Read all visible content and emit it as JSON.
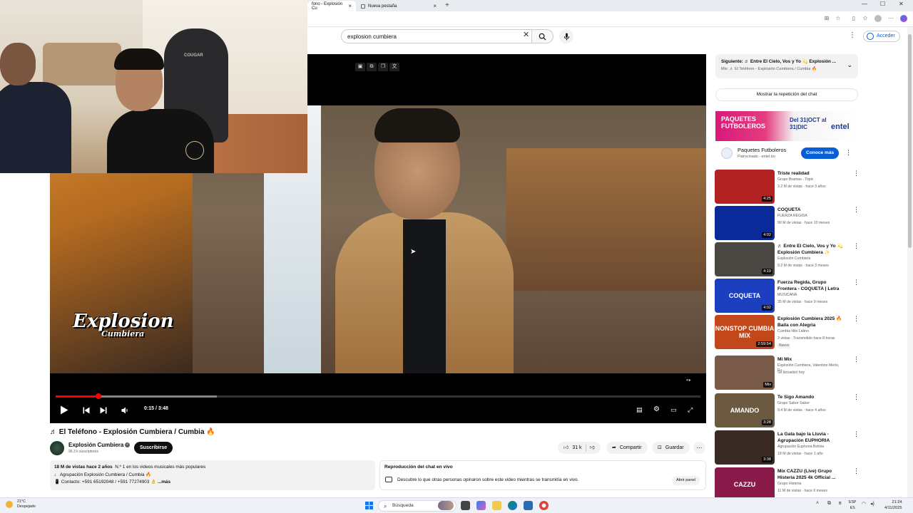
{
  "browser": {
    "tabs": [
      {
        "label": "fono - Explosión Cu",
        "active": true
      },
      {
        "label": "Nueva pestaña",
        "active": false
      }
    ]
  },
  "header": {
    "search_value": "explosion cumbiera",
    "signin_label": "Acceder"
  },
  "player": {
    "time_label": "0:15 / 3:48",
    "progress_fraction": 0.066,
    "buffer_fraction": 0.25,
    "overlay_logo_line1": "Explosion",
    "overlay_logo_line2": "Cumbiera",
    "accent_color": "#ff0000"
  },
  "webcam": {
    "chair_brand": "COUGAR"
  },
  "video": {
    "title": "♬ El Teléfono - Explosión Cumbiera / Cumbia 🔥",
    "channel": "Explosión Cumbiera",
    "subscribers": "96.3 k suscriptores",
    "subscribe_label": "Suscribirse",
    "likes": "31 k",
    "share_label": "Compartir",
    "save_label": "Guardar",
    "description": {
      "stats": "18 M de vistas  hace 2 años",
      "stats_rest": "N.º 1 en los videos musicales más populares",
      "line2": "♩ Agrupación Explosión Cumbiera / Cumbia 🔥",
      "line3": "📱 Contacto: +591 65192048 / +591 77274903 👌",
      "more": "...más"
    },
    "chat_replay": {
      "heading": "Reproducción del chat en vivo",
      "text": "Descubre lo que otras personas opinaron sobre este video mientras se transmitía en vivo.",
      "button": "Abrir panel"
    }
  },
  "sidebar": {
    "up_next_line1": "Siguiente: ♬ Entre El Cielo, Vos y Yo 💫 Explosión ...",
    "up_next_line2": "Mix: ♬ El Teléfono - Explosión Cumbiera / Cumbia 🔥",
    "show_chat": "Mostrar la repetición del chat",
    "ad": {
      "banner_left": "PAQUETES FUTBOLEROS",
      "banner_mid": "Del 31|OCT al 31|DIC",
      "banner_brand": "entel",
      "name": "Paquetes Futboleros",
      "sponsor": "Patrocinado · entel.bo",
      "cta": "Conoce más"
    },
    "items": [
      {
        "title": "Triste realidad",
        "channel": "Grupo Bramas - Topic",
        "meta": "3.2 M de vistas · hace 3 años",
        "duration": "4:25",
        "thumb_color": "#b22222",
        "thumb_text": ""
      },
      {
        "title": "COQUETA",
        "channel": "FUERZA REGIDA",
        "meta": "90 M de vistas · hace 10 meses",
        "duration": "4:02",
        "thumb_color": "#0b2a9a",
        "thumb_text": ""
      },
      {
        "title": "♬ Entre El Cielo, Vos y Yo 💫 Explosión Cumbiera ✨",
        "channel": "Explosión Cumbiera",
        "meta": "9.2 M de vistas · hace 3 meses",
        "duration": "4:19",
        "thumb_color": "#4a4642",
        "thumb_text": ""
      },
      {
        "title": "Fuerza Regida, Grupo Frontera - COQUETA | Letra",
        "channel": "MUSICANA",
        "meta": "35 M de vistas · hace 9 meses",
        "duration": "4:02",
        "thumb_color": "#1c3fbf",
        "thumb_text": "COQUETA"
      },
      {
        "title": "Explosión Cumbiera 2025 🔥 Baila con Alegria",
        "channel": "Cumbia Hits Latino",
        "meta": "3 vistas · Transmitido hace 8 horas",
        "badge": "Nuevo",
        "duration": "2:59:54",
        "thumb_color": "#c2471b",
        "thumb_text": "NONSTOP CUMBIA MIX"
      },
      {
        "title": "Mi Mix",
        "channel": "Explosión Cumbiera, Valentino Merlo, Fu...",
        "meta": "Se actualizó hoy",
        "duration": "Mix",
        "thumb_color": "#7a5a48",
        "thumb_text": ""
      },
      {
        "title": "Te Sigo Amando",
        "channel": "Grupo Sabor Sabor",
        "meta": "9.4 M de vistas · hace 4 años",
        "duration": "3:28",
        "thumb_color": "#6b5a40",
        "thumb_text": "AMANDO"
      },
      {
        "title": "La Gata bajo la Lluvia - Agrupación EUPHORIA",
        "channel": "Agrupación Euphoria Bolivia",
        "meta": "18 M de vistas · hace 1 año",
        "duration": "3:38",
        "thumb_color": "#3a2a24",
        "thumb_text": ""
      },
      {
        "title": "Mix CAZZU (Live) Grupo Histeria 2025 4k Official ...",
        "channel": "Grupo Histeria",
        "meta": "11 M de vistas · hace 6 meses",
        "duration": "",
        "thumb_color": "#8a1a4a",
        "thumb_text": "CAZZU"
      }
    ]
  },
  "taskbar": {
    "temp": "21°C",
    "weather": "Despejado",
    "search_label": "Búsqueda",
    "lang1": "ESP",
    "lang2": "ES",
    "time": "21:24",
    "date": "4/11/2025"
  }
}
